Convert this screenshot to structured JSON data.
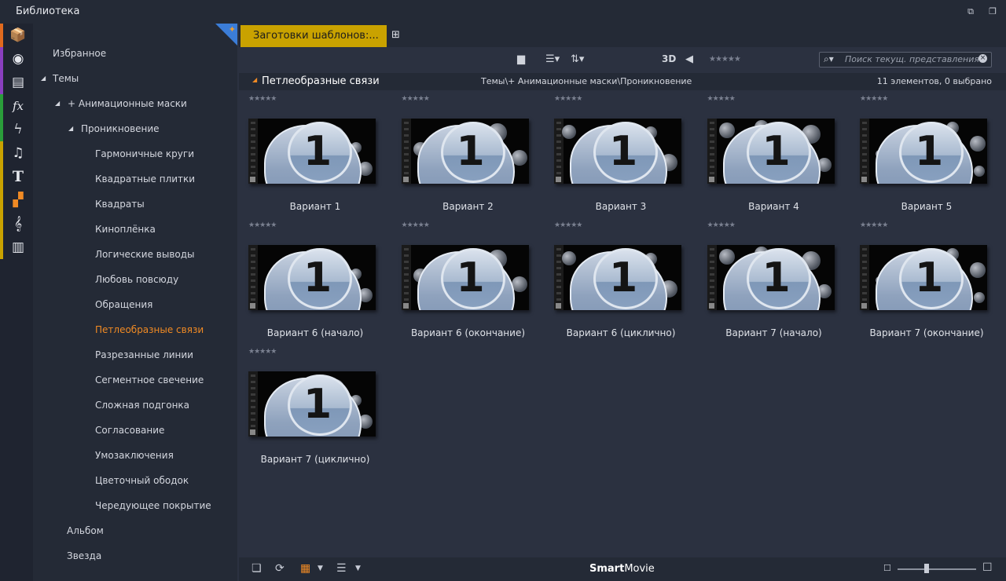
{
  "window": {
    "title": "Библиотека"
  },
  "categories": [
    {
      "name": "box-icon",
      "color": "#e06a1e",
      "glyph": "📦"
    },
    {
      "name": "film-reel-icon",
      "color": "#8a3fbf",
      "glyph": "◉"
    },
    {
      "name": "transitions-icon",
      "color": "#8a3fbf",
      "glyph": "▤"
    },
    {
      "name": "fx-icon",
      "color": "#2a9d3a",
      "glyph": "fx"
    },
    {
      "name": "lightning-icon",
      "color": "#2a9d3a",
      "glyph": "ϟ"
    },
    {
      "name": "music-note-icon",
      "color": "#c9a200",
      "glyph": "♫"
    },
    {
      "name": "title-icon",
      "color": "#c9a200",
      "glyph": "T"
    },
    {
      "name": "montage-icon",
      "color": "#c9a200",
      "glyph": "▞"
    },
    {
      "name": "treble-clef-icon",
      "color": "#c9a200",
      "glyph": "𝄞"
    },
    {
      "name": "piano-icon",
      "color": "#c9a200",
      "glyph": "▥"
    }
  ],
  "tree": {
    "favorites": "Избранное",
    "themes": "Темы",
    "anim_masks": "+ Анимационные маски",
    "penetration": "Проникновение",
    "items": [
      "Гармоничные круги",
      "Квадратные плитки",
      "Квадраты",
      "Киноплёнка",
      "Логические выводы",
      "Любовь повсюду",
      "Обращения",
      "Петлеобразные связи",
      "Разрезанные линии",
      "Сегментное свечение",
      "Сложная подгонка",
      "Согласование",
      "Умозаключения",
      "Цветочный ободок",
      "Чередующее покрытие"
    ],
    "album": "Альбом",
    "star": "Звезда"
  },
  "tab": {
    "label": "Заготовки шаблонов:..."
  },
  "toolbar": {
    "label_3d": "3D",
    "stars": "★★★★★"
  },
  "search": {
    "placeholder": "Поиск текущ. представления"
  },
  "info": {
    "folder": "Петлеобразные связи",
    "path": "Темы\\+ Анимационные маски\\Проникновение",
    "count": "11 элементов, 0 выбрано"
  },
  "grid_items": [
    "Вариант 1",
    "Вариант 2",
    "Вариант 3",
    "Вариант 4",
    "Вариант 5",
    "Вариант 6 (начало)",
    "Вариант 6 (окончание)",
    "Вариант 6 (циклично)",
    "Вариант 7 (начало)",
    "Вариант 7 (окончание)",
    "Вариант 7 (циклично)"
  ],
  "bottom": {
    "brand_bold": "Smart",
    "brand_rest": "Movie"
  },
  "thumb_number": "1"
}
